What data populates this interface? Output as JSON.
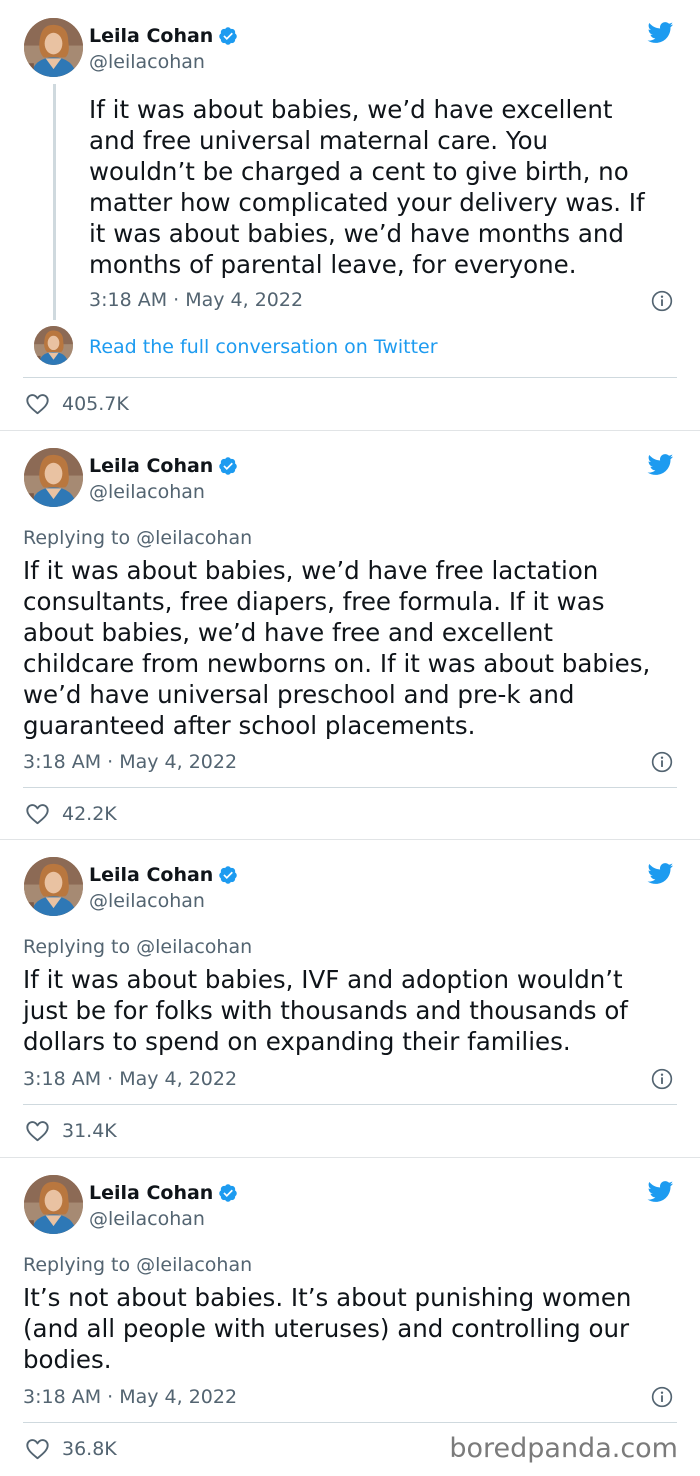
{
  "tweets": [
    {
      "name": "Leila Cohan",
      "handle": "@leilacohan",
      "reply_to": "",
      "text": "If it was about babies, we’d have excellent\nand free universal maternal care. You\nwouldn’t be charged a cent to give birth, no\nmatter how complicated your delivery was. If\nit was about babies, we’d have months and\nmonths of parental leave, for everyone.",
      "timestamp": "3:18 AM · May 4, 2022",
      "read_more": "Read the full conversation on Twitter",
      "likes": "405.7K"
    },
    {
      "name": "Leila Cohan",
      "handle": "@leilacohan",
      "reply_to": "Replying to @leilacohan",
      "text": "If it was about babies, we’d have free lactation\nconsultants, free diapers, free formula. If it was\nabout babies, we’d have free and excellent\nchildcare from newborns on. If it was about babies,\nwe’d have universal preschool and pre-k and\nguaranteed after school placements.",
      "timestamp": "3:18 AM · May 4, 2022",
      "likes": "42.2K"
    },
    {
      "name": "Leila Cohan",
      "handle": "@leilacohan",
      "reply_to": "Replying to @leilacohan",
      "text": "If it was about babies, IVF and adoption wouldn’t\njust be for folks with thousands and thousands of\ndollars to spend on expanding their families.",
      "timestamp": "3:18 AM · May 4, 2022",
      "likes": "31.4K"
    },
    {
      "name": "Leila Cohan",
      "handle": "@leilacohan",
      "reply_to": "Replying to @leilacohan",
      "text": "It’s not about babies. It’s about punishing women\n(and all people with uteruses) and controlling our\nbodies.",
      "timestamp": "3:18 AM · May 4, 2022",
      "likes": "36.8K"
    }
  ],
  "icons": {
    "verified": "verified-badge-icon",
    "brand": "twitter-bird-icon",
    "info": "info-icon",
    "like": "heart-icon"
  },
  "colors": {
    "accent": "#1d9bf0",
    "text": "#0f1419",
    "secondary": "#536471",
    "divider": "#cfd9de"
  },
  "watermark": "boredpanda.com"
}
